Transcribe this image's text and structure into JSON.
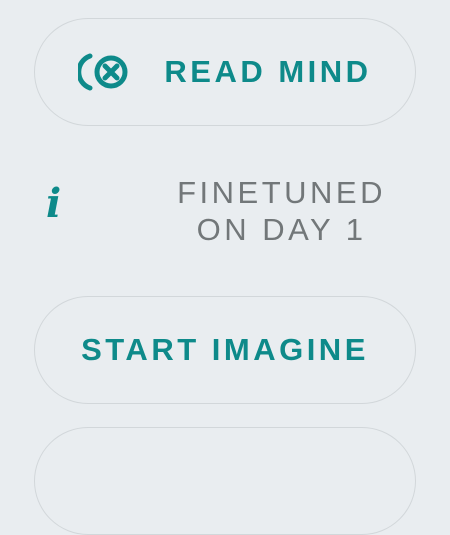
{
  "read_button": {
    "label": "READ MIND",
    "icon": "mind-cancel-icon"
  },
  "info": {
    "icon": "info-icon",
    "line1": "FINETUNED",
    "line2": "ON DAY 1"
  },
  "start_button": {
    "label": "START IMAGINE"
  },
  "colors": {
    "accent": "#0e8a8a",
    "background": "#e9edf0",
    "muted_text": "#727779",
    "border": "#d2d7da"
  }
}
